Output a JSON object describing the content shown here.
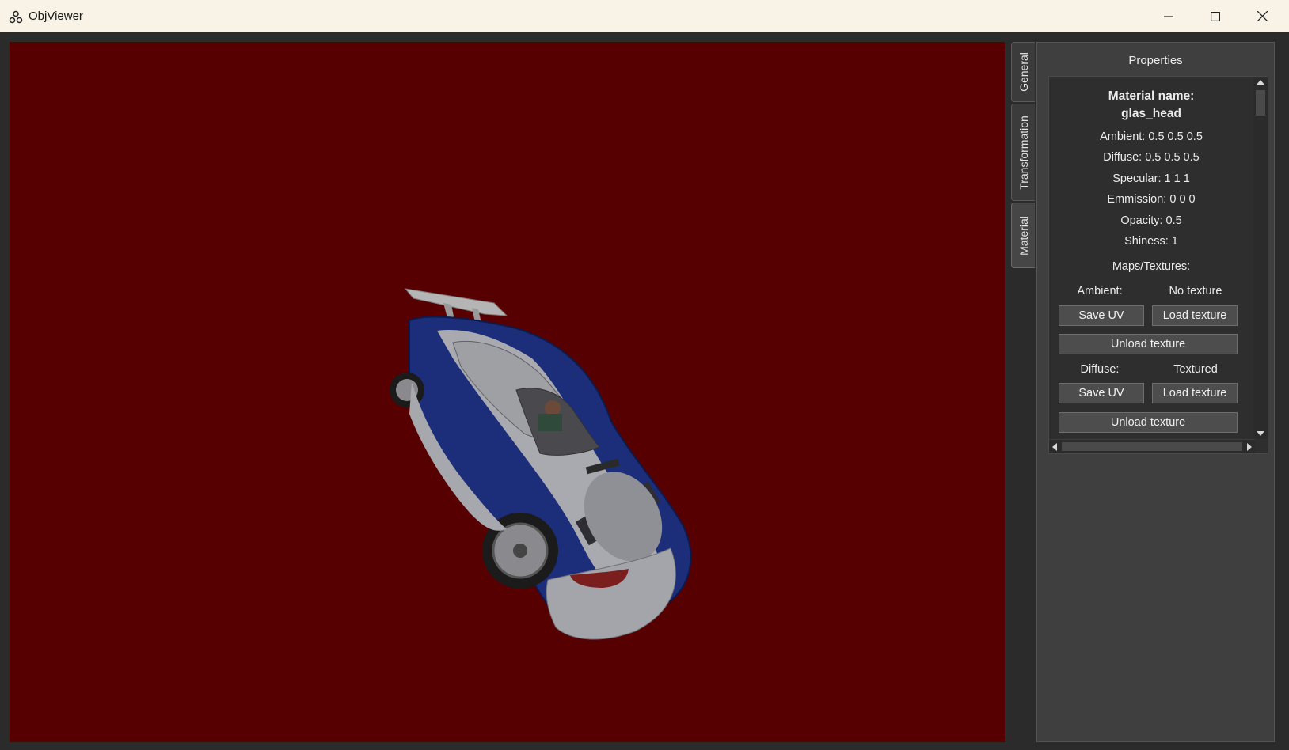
{
  "window": {
    "title": "ObjViewer",
    "icon": "share-nodes-icon",
    "controls": [
      "minimize-icon",
      "maximize-icon",
      "close-icon"
    ]
  },
  "viewport": {
    "background_color": "#560002",
    "content": "3d-car-model"
  },
  "tabs": [
    {
      "label": "General",
      "active": false
    },
    {
      "label": "Transformation",
      "active": false
    },
    {
      "label": "Material",
      "active": true
    }
  ],
  "properties": {
    "title": "Properties",
    "material_heading": "Material name:",
    "material_name": "glas_head",
    "ambient": "Ambient: 0.5 0.5 0.5",
    "diffuse": "Diffuse: 0.5 0.5 0.5",
    "specular": "Specular: 1 1 1",
    "emission": "Emmission: 0 0 0",
    "opacity": "Opacity: 0.5",
    "shininess": "Shiness: 1",
    "maps_heading": "Maps/Textures:",
    "maps": [
      {
        "label": "Ambient:",
        "status": "No texture",
        "save_uv": "Save UV",
        "load_texture": "Load texture",
        "unload_texture": "Unload texture"
      },
      {
        "label": "Diffuse:",
        "status": "Textured",
        "save_uv": "Save UV",
        "load_texture": "Load texture",
        "unload_texture": "Unload texture"
      }
    ]
  }
}
